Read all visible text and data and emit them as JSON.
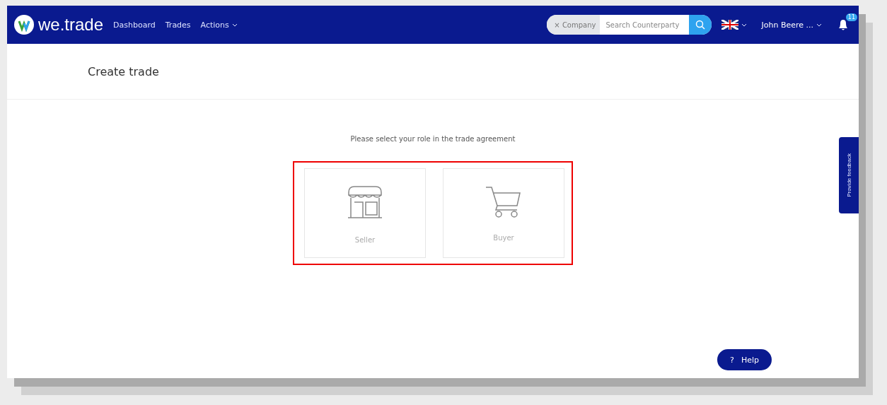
{
  "header": {
    "brand": "we.trade",
    "nav": [
      {
        "label": "Dashboard",
        "kind": "link"
      },
      {
        "label": "Trades",
        "kind": "link"
      },
      {
        "label": "Actions",
        "kind": "dropdown"
      }
    ],
    "search": {
      "filter": "× Company",
      "placeholder": "Search Counterparty"
    },
    "user": "John Beere ...",
    "notifications": "11"
  },
  "page_title": "Create trade",
  "prompt": "Please select your role in the trade agreement",
  "roles": [
    {
      "kind": "seller",
      "label": "Seller"
    },
    {
      "kind": "buyer",
      "label": "Buyer"
    }
  ],
  "feedback_tab": "Provide feedback",
  "help_button": {
    "icon": "?",
    "label": "Help"
  }
}
